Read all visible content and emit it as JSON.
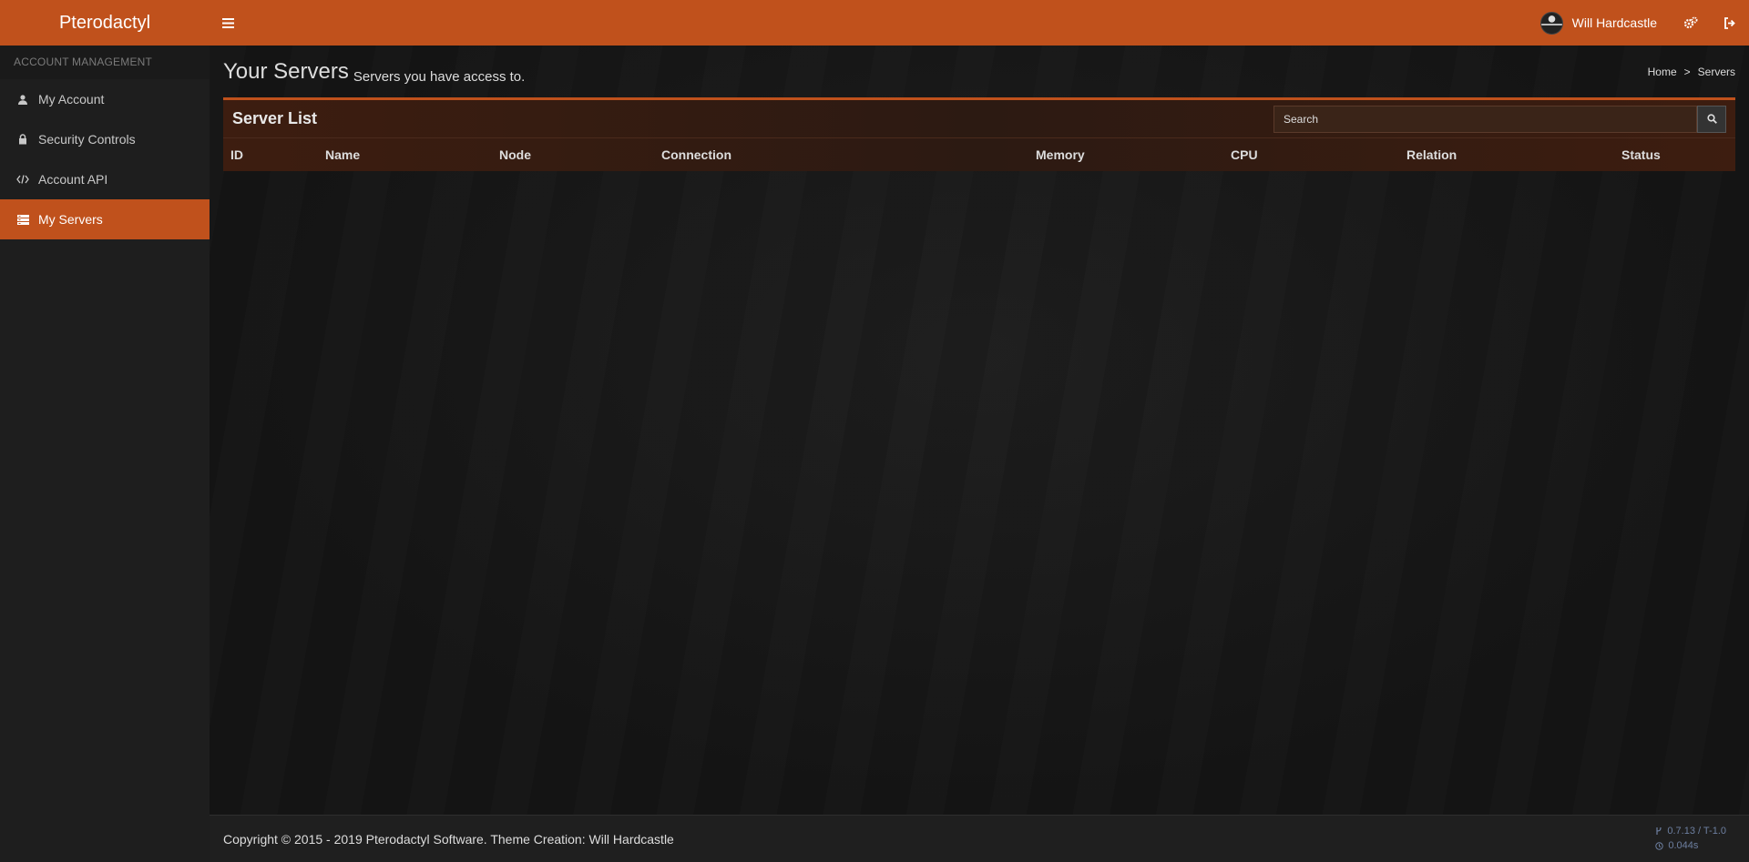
{
  "brand": {
    "name": "Pterodactyl"
  },
  "header": {
    "user_name": "Will Hardcastle",
    "icons": [
      "menu-icon",
      "gears-icon",
      "sign-out-icon"
    ]
  },
  "sidebar": {
    "section_title": "ACCOUNT MANAGEMENT",
    "items": [
      {
        "label": "My Account",
        "icon": "user-icon",
        "active": false
      },
      {
        "label": "Security Controls",
        "icon": "lock-icon",
        "active": false
      },
      {
        "label": "Account API",
        "icon": "code-icon",
        "active": false
      },
      {
        "label": "My Servers",
        "icon": "server-icon",
        "active": true
      }
    ]
  },
  "page": {
    "title": "Your Servers",
    "subtitle": "Servers you have access to.",
    "breadcrumb": [
      "Home",
      ">",
      "Servers"
    ]
  },
  "server_list": {
    "title": "Server List",
    "search_placeholder": "Search",
    "columns": [
      "ID",
      "Name",
      "Node",
      "Connection",
      "Memory",
      "CPU",
      "Relation",
      "Status"
    ],
    "rows": []
  },
  "footer": {
    "copyright": "Copyright © 2015 - 2019 Pterodactyl Software. Theme Creation: Will Hardcastle",
    "version": "0.7.13 / T-1.0",
    "render_time": "0.044s"
  },
  "colors": {
    "accent": "#c0511c",
    "sidebar": "#1e1e1e",
    "background": "#141414"
  }
}
